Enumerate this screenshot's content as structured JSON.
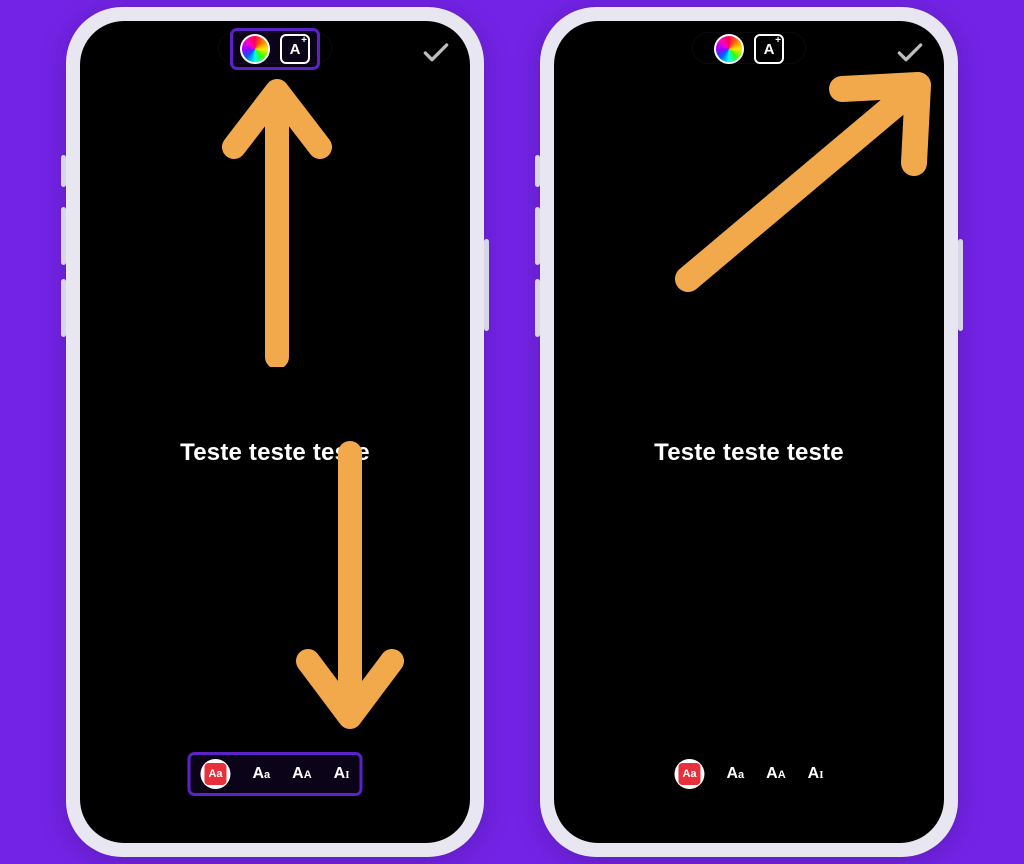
{
  "colors": {
    "background": "#7323E6",
    "arrow": "#F2A94C",
    "highlight": "#5B22C8",
    "font_chip_accent": "#E8303A"
  },
  "phones": [
    {
      "story_text": "Teste teste teste",
      "top_tools_highlighted": true,
      "fontbar_highlighted": true,
      "top_tools": {
        "abox_label": "A",
        "abox_plus": "+"
      },
      "font_options": [
        {
          "label": "Aa",
          "selected": true
        },
        {
          "label_html": "A<span class='sub'>a</span>",
          "selected": false
        },
        {
          "label_html": "A<span class='sub'>A</span>",
          "selected": false
        },
        {
          "label_html": "A<span class='sub'>I</span>",
          "selected": false
        }
      ],
      "arrows": [
        "up",
        "down"
      ]
    },
    {
      "story_text": "Teste teste teste",
      "top_tools_highlighted": false,
      "fontbar_highlighted": false,
      "top_tools": {
        "abox_label": "A",
        "abox_plus": "+"
      },
      "font_options": [
        {
          "label": "Aa",
          "selected": true
        },
        {
          "label_html": "A<span class='sub'>a</span>",
          "selected": false
        },
        {
          "label_html": "A<span class='sub'>A</span>",
          "selected": false
        },
        {
          "label_html": "A<span class='sub'>I</span>",
          "selected": false
        }
      ],
      "arrows": [
        "diag-up-right"
      ]
    }
  ]
}
